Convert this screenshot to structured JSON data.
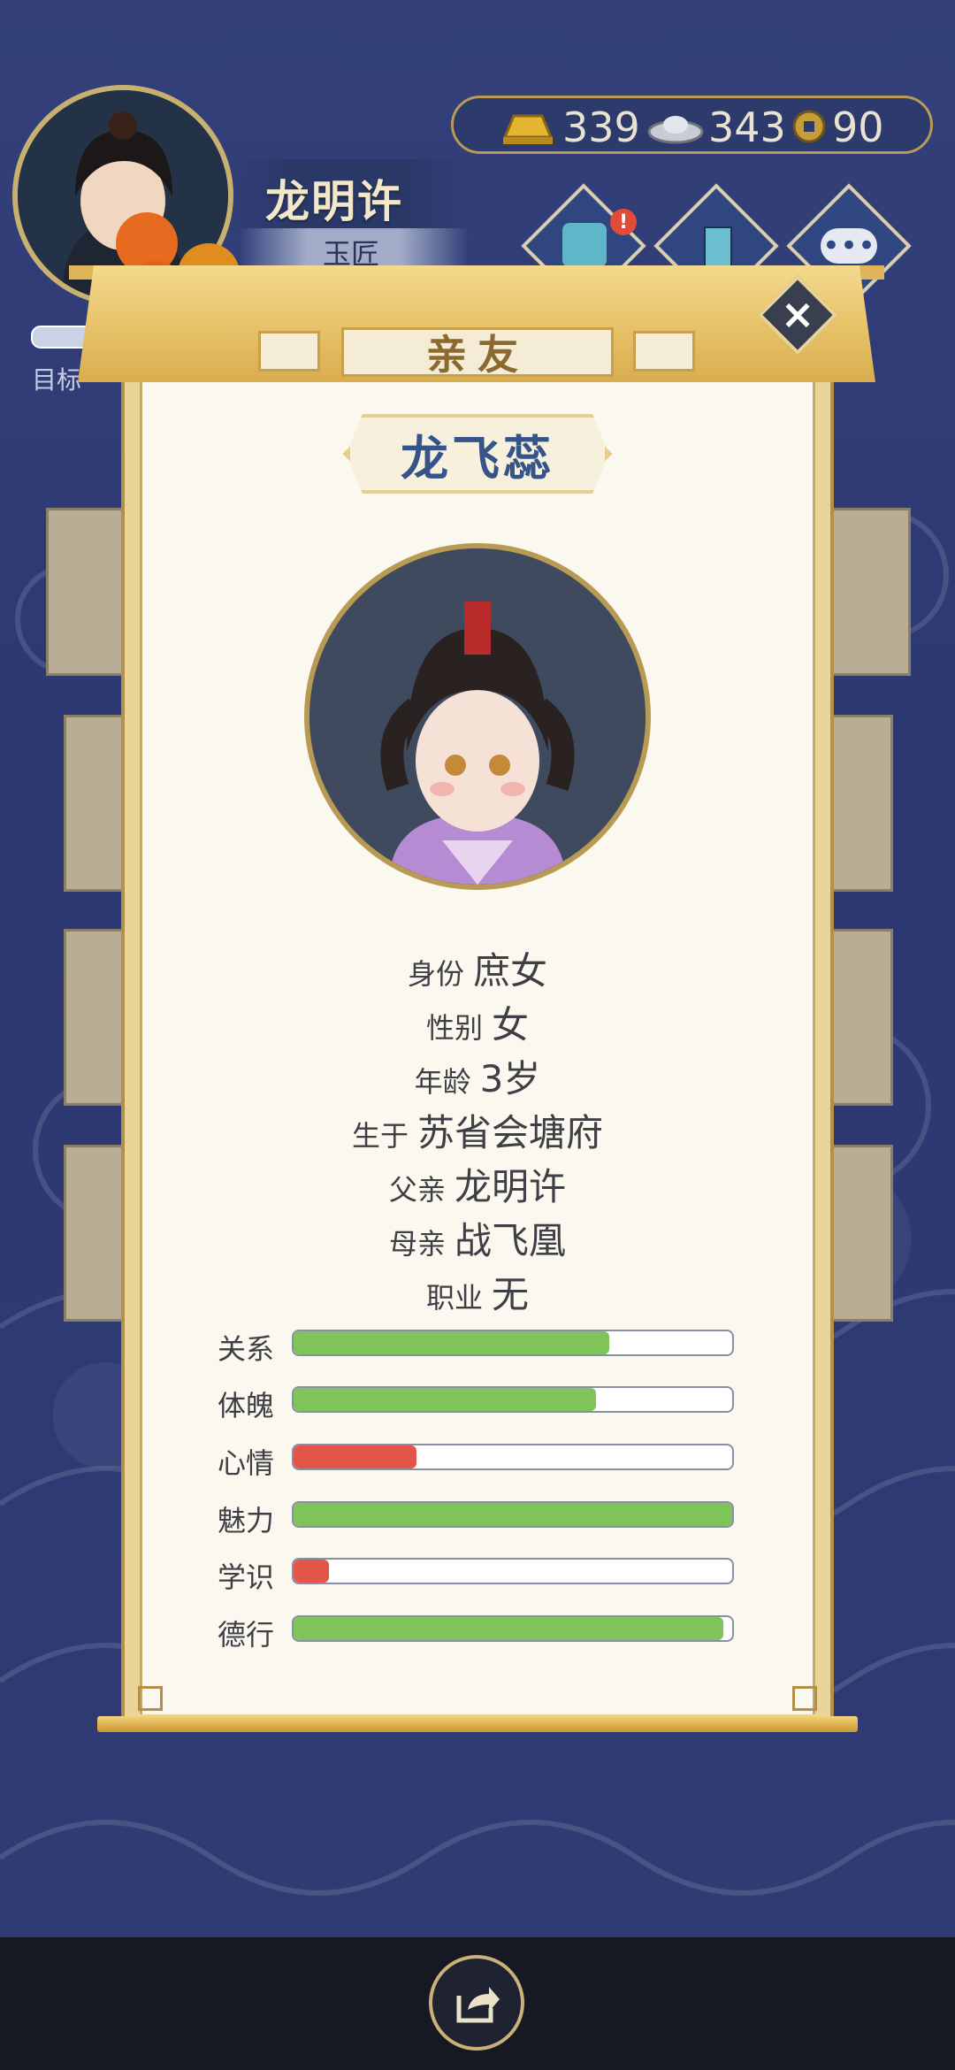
{
  "player": {
    "name": "龙明许",
    "job": "玉匠",
    "target_label": "目标"
  },
  "currency": {
    "gold": "339",
    "silver": "343",
    "coin": "90"
  },
  "dialog": {
    "title": "亲友",
    "person_name": "龙飞蕊",
    "info": [
      {
        "label": "身份",
        "value": "庶女"
      },
      {
        "label": "性别",
        "value": "女"
      },
      {
        "label": "年龄",
        "value": "3岁"
      },
      {
        "label": "生于",
        "value": "苏省会塘府"
      },
      {
        "label": "父亲",
        "value": "龙明许"
      },
      {
        "label": "母亲",
        "value": "战飞凰"
      },
      {
        "label": "职业",
        "value": "无"
      }
    ],
    "stats": [
      {
        "label": "关系",
        "level": 0.72,
        "color": "#7fc35b"
      },
      {
        "label": "体魄",
        "level": 0.69,
        "color": "#7fc35b"
      },
      {
        "label": "心情",
        "level": 0.28,
        "color": "#e2564a"
      },
      {
        "label": "魅力",
        "level": 1.0,
        "color": "#7fc35b"
      },
      {
        "label": "学识",
        "level": 0.08,
        "color": "#e2564a"
      },
      {
        "label": "德行",
        "level": 0.98,
        "color": "#7fc35b"
      }
    ]
  },
  "colors": {
    "accent_gold": "#c79f4e",
    "name_blue": "#35548a",
    "bar_green": "#7fc35b",
    "bar_red": "#e2564a"
  },
  "icons": [
    "gold-ingot-icon",
    "silver-ingot-icon",
    "copper-coin-icon",
    "gift-icon",
    "book-icon",
    "more-icon",
    "close-icon",
    "share-icon"
  ]
}
